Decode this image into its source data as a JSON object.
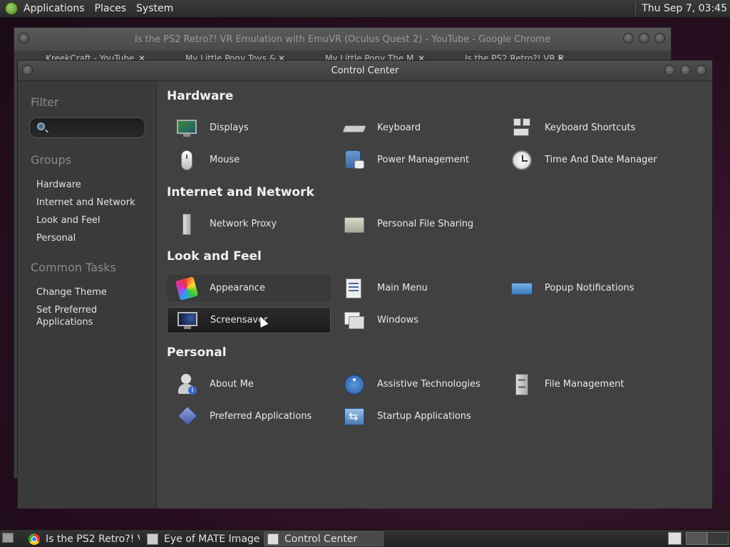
{
  "top_panel": {
    "menus": [
      "Applications",
      "Places",
      "System"
    ],
    "clock": "Thu Sep  7, 03:45"
  },
  "chrome_window": {
    "title": "Is the PS2 Retro?! VR Emulation with EmuVR (Oculus Quest 2) - YouTube - Google Chrome",
    "tabs": [
      "KreekCraft - YouTube",
      "My Little Pony Toys &",
      "My Little Pony The M",
      "Is the PS2 Retro?! VR E"
    ]
  },
  "control_center": {
    "title": "Control Center",
    "sidebar": {
      "filter_heading": "Filter",
      "search_placeholder": "",
      "groups_heading": "Groups",
      "groups": [
        "Hardware",
        "Internet and Network",
        "Look and Feel",
        "Personal"
      ],
      "tasks_heading": "Common Tasks",
      "tasks": [
        "Change Theme",
        "Set Preferred Applications"
      ]
    },
    "sections": [
      {
        "title": "Hardware",
        "items": [
          "Displays",
          "Keyboard",
          "Keyboard Shortcuts",
          "Mouse",
          "Power Management",
          "Time And Date Manager"
        ]
      },
      {
        "title": "Internet and Network",
        "items": [
          "Network Proxy",
          "Personal File Sharing"
        ]
      },
      {
        "title": "Look and Feel",
        "items": [
          "Appearance",
          "Main Menu",
          "Popup Notifications",
          "Screensaver",
          "Windows"
        ]
      },
      {
        "title": "Personal",
        "items": [
          "About Me",
          "Assistive Technologies",
          "File Management",
          "Preferred Applications",
          "Startup Applications"
        ]
      }
    ],
    "icons": {
      "displays": "monitor-icon",
      "keyboard": "keyboard-icon",
      "shortcuts": "keyboard-shortcuts-icon",
      "mouse": "mouse-icon",
      "power": "power-management-icon",
      "time": "clock-icon",
      "proxy": "network-proxy-icon",
      "sharing": "folder-share-icon",
      "appearance": "appearance-icon",
      "menu": "main-menu-icon",
      "popup": "popup-notification-icon",
      "screensaver": "screensaver-icon",
      "windows": "windows-icon",
      "about": "about-me-icon",
      "assistive": "accessibility-icon",
      "files": "file-cabinet-icon",
      "preferred": "preferred-apps-icon",
      "startup": "startup-apps-icon"
    }
  },
  "taskbar": {
    "tasks": [
      "Is the PS2 Retro?! V...",
      "Eye of MATE Image ...",
      "Control Center"
    ],
    "active_task": "Control Center"
  },
  "colors": {
    "panel": "#2b2b2b",
    "sidebar": "#3a3a3a",
    "main": "#414141",
    "selected_item": "#1c1c1c"
  }
}
